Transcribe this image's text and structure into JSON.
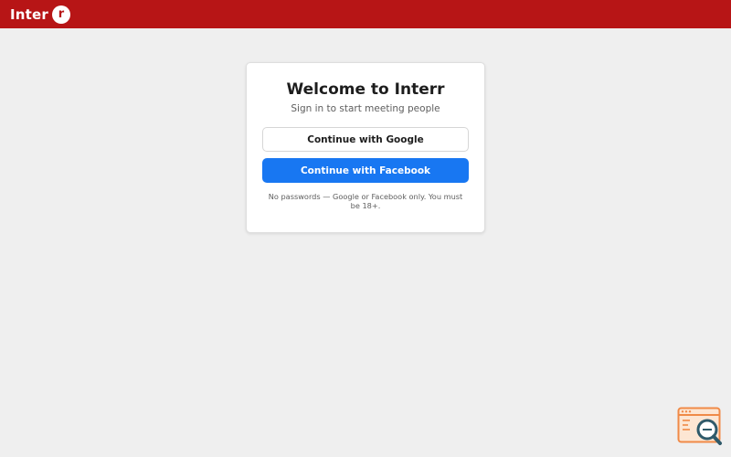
{
  "header": {
    "brand_text": "Inter",
    "brand_mark": "r",
    "background_color": "#b71516"
  },
  "login_card": {
    "title": "Welcome to Interr",
    "subtitle": "Sign in to start meeting people",
    "google_button_label": "Continue with Google",
    "facebook_button_label": "Continue with Facebook",
    "facebook_color": "#1877f2",
    "note": "No passwords — Google or Facebook only. You must be 18+."
  },
  "widgets": {
    "corner_icon": "browser-search-icon"
  }
}
